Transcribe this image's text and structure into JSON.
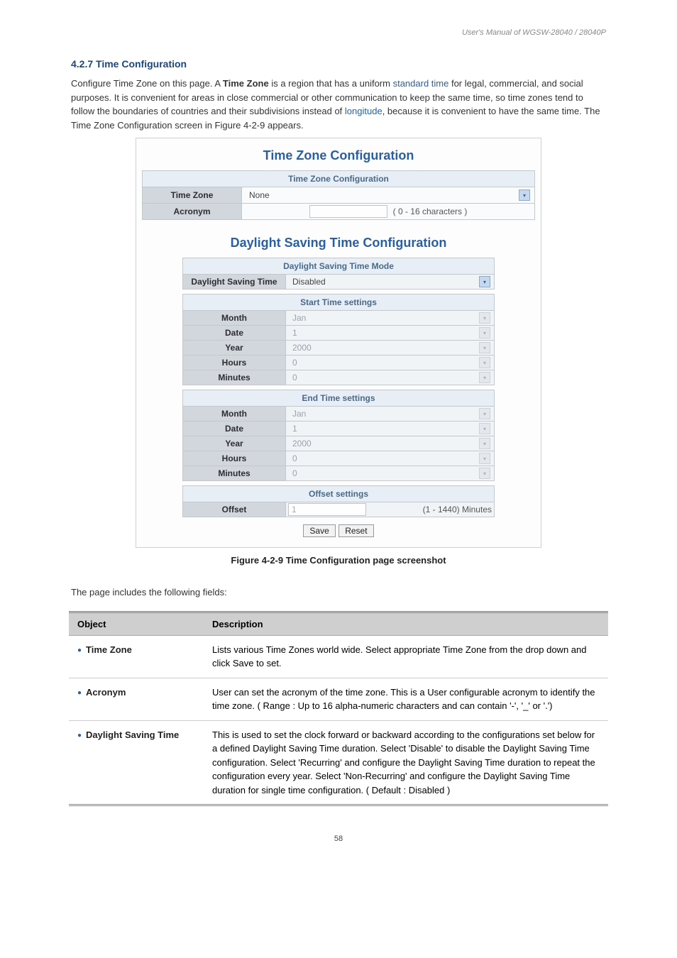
{
  "product_header": "User's Manual of WGSW-28040 / 28040P",
  "intro_text": "The Time Zone Configuration screen in Figure 4-2-9 appears.",
  "figure": {
    "main_heading": "Time Zone Configuration",
    "tz_section": "Time Zone Configuration",
    "tz_label": "Time Zone",
    "tz_value": "None",
    "acronym_label": "Acronym",
    "acronym_value": "",
    "acronym_hint": "( 0 - 16 characters )",
    "dst_heading": "Daylight Saving Time Configuration",
    "dst_mode_section": "Daylight Saving Time Mode",
    "dst_label": "Daylight Saving Time",
    "dst_value": "Disabled",
    "start_section": "Start Time settings",
    "end_section": "End Time settings",
    "offset_section": "Offset settings",
    "rows": {
      "month": "Month",
      "date": "Date",
      "year": "Year",
      "hours": "Hours",
      "minutes": "Minutes",
      "offset": "Offset"
    },
    "start_vals": {
      "month": "Jan",
      "date": "1",
      "year": "2000",
      "hours": "0",
      "minutes": "0"
    },
    "end_vals": {
      "month": "Jan",
      "date": "1",
      "year": "2000",
      "hours": "0",
      "minutes": "0"
    },
    "offset_value": "1",
    "offset_hint": "(1 - 1440) Minutes",
    "save_btn": "Save",
    "reset_btn": "Reset"
  },
  "figure_caption": "Figure 4-2-9 Time Configuration page screenshot",
  "desc_intro": "The page includes the following fields:",
  "table_head": {
    "object": "Object",
    "description": "Description"
  },
  "table_rows": [
    {
      "object": "Time Zone",
      "desc": "Lists various Time Zones world wide. Select appropriate Time Zone from the drop down and click Save to set."
    },
    {
      "object": "Acronym",
      "desc": "User can set the acronym of the time zone. This is a User configurable acronym to identify the time zone. ( Range : Up to 16 alpha-numeric characters and can contain '-', '_' or '.')"
    },
    {
      "object": "Daylight Saving Time",
      "desc": "This is used to set the clock forward or backward according to the configurations set below for a defined Daylight Saving Time duration. Select 'Disable' to disable the Daylight Saving Time configuration. Select 'Recurring' and configure the Daylight Saving Time duration to repeat the configuration every year. Select 'Non-Recurring' and configure the Daylight Saving Time duration for single time configuration. ( Default : Disabled )"
    }
  ],
  "footer": "58"
}
